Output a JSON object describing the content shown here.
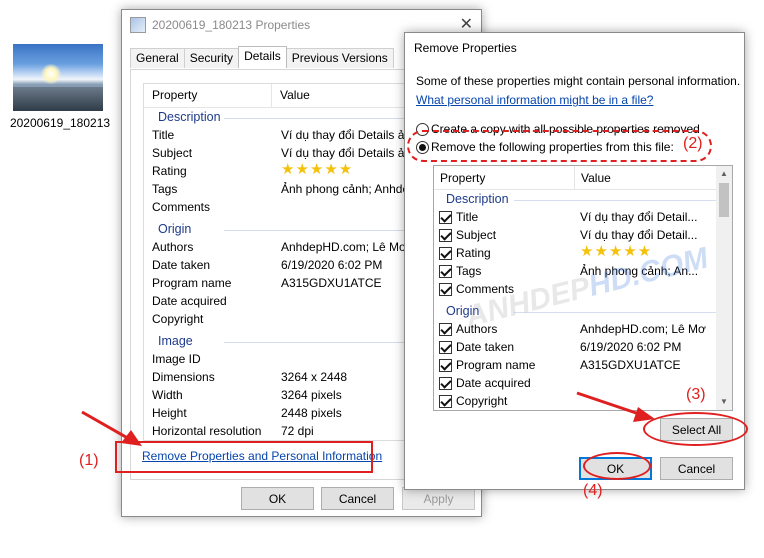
{
  "desktop": {
    "file_label": "20200619_180213"
  },
  "props": {
    "title": "20200619_180213 Properties",
    "tabs": [
      {
        "label": "General"
      },
      {
        "label": "Security"
      },
      {
        "label": "Details"
      },
      {
        "label": "Previous Versions"
      }
    ],
    "active_tab": "Details",
    "col_property": "Property",
    "col_value": "Value",
    "sections": {
      "description": "Description",
      "origin": "Origin",
      "image": "Image"
    },
    "rows": {
      "title": {
        "k": "Title",
        "v": "Ví dụ thay đổi Details ảnh"
      },
      "subject": {
        "k": "Subject",
        "v": "Ví dụ thay đổi Details ảnh"
      },
      "rating": {
        "k": "Rating",
        "stars": 5
      },
      "tags": {
        "k": "Tags",
        "v": "Ảnh phong cảnh; AnhdepHD"
      },
      "comments": {
        "k": "Comments",
        "v": ""
      },
      "authors": {
        "k": "Authors",
        "v": "AnhdepHD.com; Lê Mơ"
      },
      "date_taken": {
        "k": "Date taken",
        "v": "6/19/2020 6:02 PM"
      },
      "program": {
        "k": "Program name",
        "v": "A315GDXU1ATCE"
      },
      "date_acquired": {
        "k": "Date acquired",
        "v": ""
      },
      "copyright": {
        "k": "Copyright",
        "v": ""
      },
      "image_id": {
        "k": "Image ID",
        "v": ""
      },
      "dimensions": {
        "k": "Dimensions",
        "v": "3264 x 2448"
      },
      "width": {
        "k": "Width",
        "v": "3264 pixels"
      },
      "height": {
        "k": "Height",
        "v": "2448 pixels"
      },
      "hres": {
        "k": "Horizontal resolution",
        "v": "72 dpi"
      }
    },
    "remove_link": "Remove Properties and Personal Information",
    "ok": "OK",
    "cancel": "Cancel",
    "apply": "Apply"
  },
  "remove": {
    "title": "Remove Properties",
    "intro": "Some of these properties might contain personal information.",
    "info_link": "What personal information might be in a file?",
    "option_copy": "Create a copy with all possible properties removed",
    "option_remove": "Remove the following properties from this file:",
    "selected_option": "remove",
    "col_property": "Property",
    "col_value": "Value",
    "sections": {
      "description": "Description",
      "origin": "Origin"
    },
    "rows": {
      "title": {
        "k": "Title",
        "v": "Ví dụ thay đổi Detail...",
        "checked": true
      },
      "subject": {
        "k": "Subject",
        "v": "Ví dụ thay đổi Detail...",
        "checked": true
      },
      "rating": {
        "k": "Rating",
        "stars": 5,
        "checked": true
      },
      "tags": {
        "k": "Tags",
        "v": "Ảnh phong cảnh; An...",
        "checked": true
      },
      "comments": {
        "k": "Comments",
        "v": "",
        "checked": true
      },
      "authors": {
        "k": "Authors",
        "v": "AnhdepHD.com; Lê Mơ",
        "checked": true
      },
      "date_taken": {
        "k": "Date taken",
        "v": "6/19/2020 6:02 PM",
        "checked": true
      },
      "program": {
        "k": "Program name",
        "v": "A315GDXU1ATCE",
        "checked": true
      },
      "date_acquired": {
        "k": "Date acquired",
        "v": "",
        "checked": true
      },
      "copyright": {
        "k": "Copyright",
        "v": "",
        "checked": true
      }
    },
    "select_all": "Select All",
    "ok": "OK",
    "cancel": "Cancel"
  },
  "watermark": {
    "part1": "ANHDEP",
    "part2": "HD",
    "part3": ".COM"
  },
  "annotations": {
    "step1": "(1)",
    "step2": "(2)",
    "step3": "(3)",
    "step4": "(4)",
    "color": "#e02020"
  }
}
